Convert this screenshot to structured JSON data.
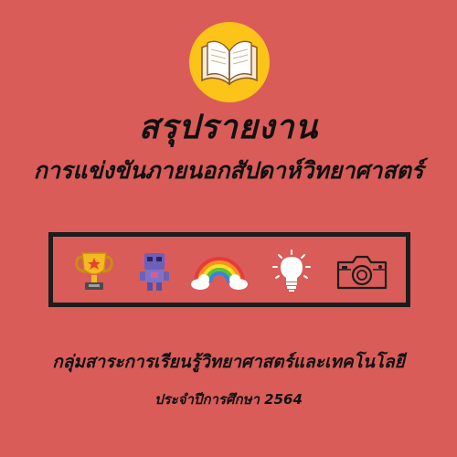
{
  "title": "สรุปรายงาน",
  "subtitle": "การแข่งขันภายนอกสัปดาห์วิทยาศาสตร์",
  "icons": [
    "open-book-icon",
    "trophy-icon",
    "robot-icon",
    "rainbow-icon",
    "light-bulb-icon",
    "camera-icon"
  ],
  "department": "กลุ่มสาระการเรียนรู้วิทยาศาสตร์และเทคโนโลยี",
  "academic_year": "ประจำปีการศึกษา 2564",
  "colors": {
    "background": "#d95c59",
    "logo_circle": "#fcc419",
    "text": "#111111",
    "frame": "#1c1c1c"
  }
}
